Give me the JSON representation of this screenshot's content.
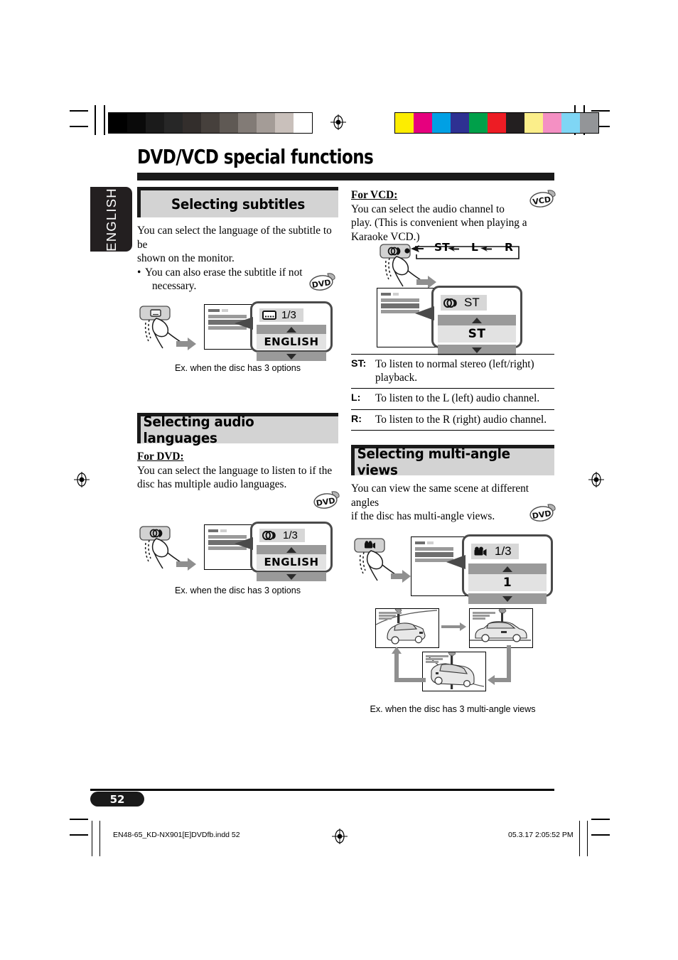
{
  "document": {
    "title": "DVD/VCD special functions",
    "language_tab": "ENGLISH",
    "page_number": "52",
    "footer_file": "EN48-65_KD-NX901[E]DVDfb.indd   52",
    "footer_timestamp": "05.3.17   2:05:52 PM"
  },
  "colors": {
    "heading_band": "#d3d3d3",
    "rule": "#1a1a1a",
    "callout_border": "#4a4a4a",
    "bar_gray": "#9a9a9a",
    "value_gray": "#e2e2e2",
    "chip_gray": "#d7d7d7"
  },
  "registration": {
    "grayscale_swatches": [
      "#000000",
      "#0a0a0a",
      "#1b1b1b",
      "#272727",
      "#332e2c",
      "#46403c",
      "#5f5954",
      "#827b76",
      "#a49c97",
      "#c9c0bb",
      "#ffffff"
    ],
    "color_swatches": [
      "#fded00",
      "#e6007e",
      "#00a0e4",
      "#2e3192",
      "#00a04a",
      "#ed1c24",
      "#231f20",
      "#fbee8a",
      "#f490c3",
      "#7fd6f5",
      "#939598"
    ]
  },
  "sections": {
    "subtitles": {
      "heading": "Selecting subtitles",
      "body_line1": "You can select the language of the subtitle to be",
      "body_line2": "shown on the monitor.",
      "bullet_1_line1": "You can also erase the subtitle if not",
      "bullet_1_line2": "necessary.",
      "bullet_char": "•",
      "disc_badge": "DVD",
      "callout": {
        "index": "1/3",
        "value": "ENGLISH",
        "icon": "subtitle-icon"
      },
      "caption": "Ex. when the disc has 3 options"
    },
    "audio_languages": {
      "heading": "Selecting audio languages",
      "for_dvd_label": "For DVD:",
      "dvd_body_line1": "You can select the language to listen to if the",
      "dvd_body_line2": "disc has multiple audio languages.",
      "disc_badge": "DVD",
      "callout": {
        "index": "1/3",
        "value": "ENGLISH",
        "icon": "audio-icon"
      },
      "caption": "Ex. when the disc has 3 options",
      "for_vcd_label": "For VCD:",
      "vcd_body_line1": "You can select the audio channel to",
      "vcd_body_line2": "play. (This is convenient when playing a",
      "vcd_body_line3": "Karaoke VCD.)",
      "vcd_badge": "VCD",
      "cycle_sequence": [
        "ST",
        "L",
        "R"
      ],
      "vcd_callout": {
        "index": "ST",
        "value": "ST",
        "icon": "audio-icon"
      },
      "definitions": [
        {
          "key": "ST:",
          "text_line1": "To listen to normal stereo (left/right)",
          "text_line2": "playback."
        },
        {
          "key": "L:",
          "text_line1": "To listen to the L (left) audio channel.",
          "text_line2": ""
        },
        {
          "key": "R:",
          "text_line1": "To listen to the R (right) audio channel.",
          "text_line2": ""
        }
      ]
    },
    "multi_angle": {
      "heading": "Selecting multi-angle views",
      "body_line1": "You can view the same scene at different angles",
      "body_line2": "if the disc has multi-angle views.",
      "disc_badge": "DVD",
      "callout": {
        "index": "1/3",
        "value": "1",
        "icon": "angle-camera-icon"
      },
      "caption": "Ex. when the disc has 3 multi-angle views",
      "scene_count": 3
    }
  }
}
